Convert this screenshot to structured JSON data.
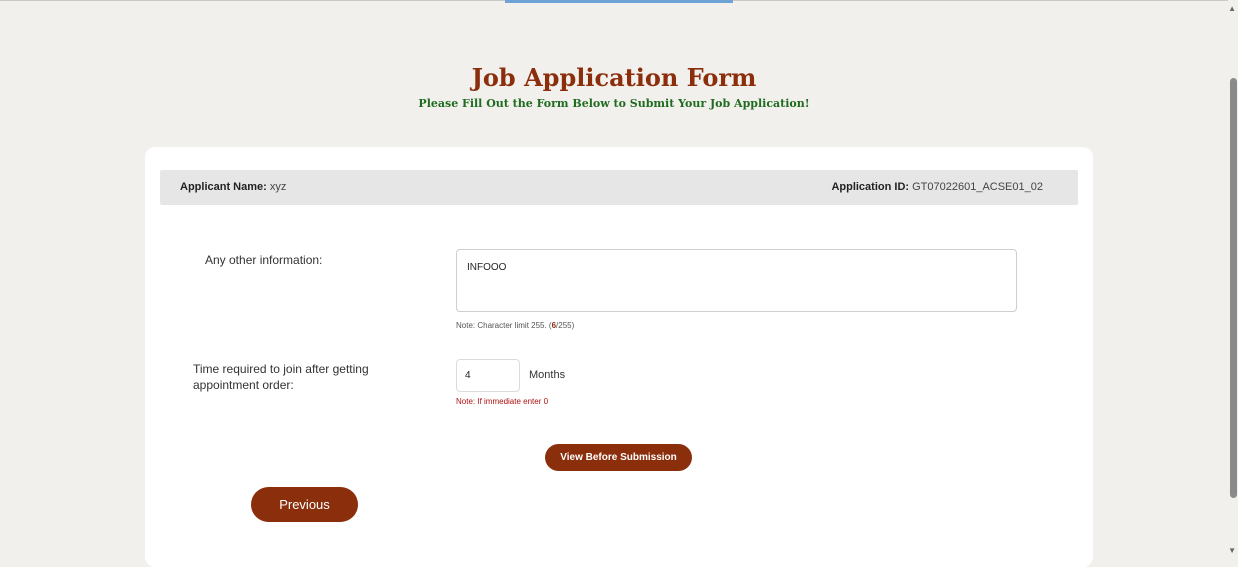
{
  "header": {
    "title": "Job Application Form",
    "subtitle": "Please Fill Out the Form Below to Submit Your Job Application!"
  },
  "applicant": {
    "name_label": "Applicant Name:",
    "name_value": "xyz",
    "id_label": "Application ID:",
    "id_value": "GT07022601_ACSE01_02"
  },
  "form": {
    "other_info": {
      "label": "Any other information:",
      "value": "INFOOO",
      "note_prefix": "Note: Character limit 255. (",
      "note_count": "6",
      "note_suffix": "/255)"
    },
    "join_time": {
      "label_line1": "Time required to join after getting",
      "label_line2": "appointment order:",
      "value": "4",
      "unit": "Months",
      "note": "Note: If immediate enter 0"
    }
  },
  "buttons": {
    "view": "View Before Submission",
    "previous": "Previous"
  },
  "colors": {
    "accent": "#8b2e0c",
    "subtitle": "#1f6b1f",
    "warning": "#b01010",
    "background": "#f1f0ec"
  }
}
